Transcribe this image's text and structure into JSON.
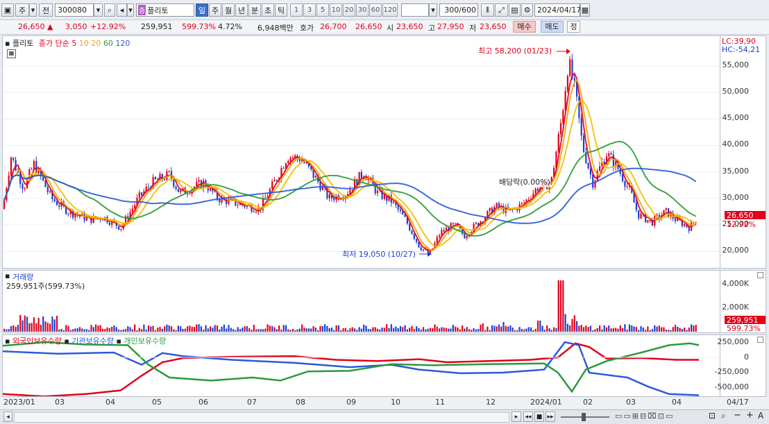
{
  "toolbar": {
    "market": "주",
    "scope": "전",
    "code": "300080",
    "name": "플리토",
    "name_badge": "증",
    "periods": [
      "일",
      "주",
      "월",
      "년",
      "분",
      "초",
      "틱"
    ],
    "active_period": "일",
    "numbers": [
      "1",
      "3",
      "5",
      "10",
      "20",
      "30",
      "60",
      "120"
    ],
    "count": "300",
    "count_total": "/600",
    "date": "2024/04/17"
  },
  "quote": {
    "price": "26,650",
    "change": "3,050",
    "change_pct": "+12.92%",
    "volume": "259,951",
    "volume_ratio": "599.73%",
    "turnover": "4.72%",
    "amount": "6,948백만",
    "bid_label": "호가",
    "ask": "26,700",
    "bid": "26,650",
    "open_label": "시",
    "open": "23,650",
    "high_label": "고",
    "high": "27,950",
    "low_label": "저",
    "low": "23,650",
    "buy_label": "매수",
    "sell_label": "매도",
    "correct_label": "정"
  },
  "price_panel": {
    "legend_name": "플리토",
    "legend_series": "종가 단순",
    "ma_periods": [
      "5",
      "10",
      "20",
      "60",
      "120"
    ],
    "ma_colors": [
      "#e0001b",
      "#f5a300",
      "#f0c000",
      "#2a9a3a",
      "#2a5ad8"
    ],
    "lc": "LC:39,90",
    "hc": "HC:-54,21",
    "high_note": "최고 58,200 (01/23)",
    "low_note": "최저 19,050 (10/27)",
    "dividend_note": "배당락(0.00%)",
    "price_tag": "26,650",
    "pct_tag": "12.92%",
    "y_ticks": [
      "55,000",
      "50,000",
      "45,000",
      "40,000",
      "35,000",
      "30,000",
      "25,000",
      "20,000"
    ]
  },
  "volume_panel": {
    "title": "거래량",
    "value_text": "259,951주(599.73%)",
    "vol_tag": "259,951",
    "pct_tag": "599.73%",
    "y_ticks": [
      "4,000K",
      "2,000K"
    ]
  },
  "holdings_panel": {
    "series": [
      {
        "name": "외국인보유수량",
        "color": "#e0001b"
      },
      {
        "name": "기관보유수량",
        "color": "#2a5ad8"
      },
      {
        "name": "개인보유수량",
        "color": "#2a9a3a"
      }
    ],
    "y_ticks": [
      "250,000",
      "0",
      "-250,000",
      "-500,000"
    ]
  },
  "x_axis": [
    "2023/01",
    "03",
    "04",
    "05",
    "06",
    "07",
    "08",
    "09",
    "10",
    "11",
    "12",
    "2024/01",
    "02",
    "03",
    "04",
    "04/17"
  ]
}
